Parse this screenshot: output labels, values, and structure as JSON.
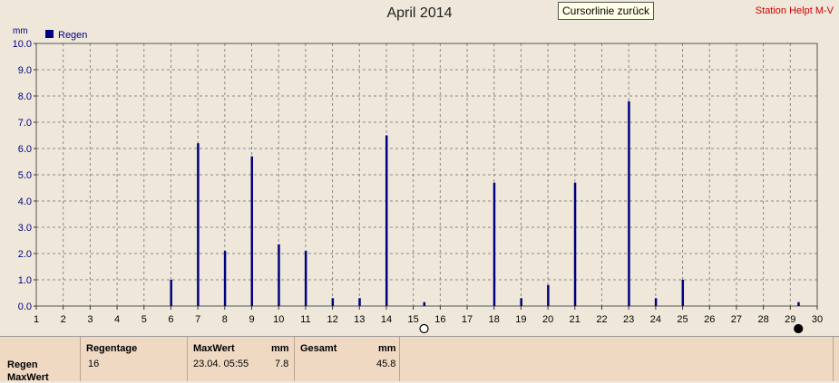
{
  "chart_data": {
    "type": "bar",
    "title": "April 2014",
    "ylabel": "mm",
    "ylim": [
      0,
      10
    ],
    "y_ticks": [
      "0.0",
      "1.0",
      "2.0",
      "3.0",
      "4.0",
      "5.0",
      "6.0",
      "7.0",
      "8.0",
      "9.0",
      "10.0"
    ],
    "xlim": [
      1,
      30
    ],
    "x_ticks": [
      "1",
      "2",
      "3",
      "4",
      "5",
      "6",
      "7",
      "8",
      "9",
      "10",
      "11",
      "12",
      "13",
      "14",
      "15",
      "16",
      "17",
      "18",
      "19",
      "20",
      "21",
      "22",
      "23",
      "24",
      "25",
      "26",
      "27",
      "28",
      "29",
      "30"
    ],
    "grid": true,
    "legend": "top-left",
    "series": [
      {
        "name": "Regen",
        "color": "#000080",
        "x": [
          6,
          7,
          8,
          9,
          10,
          11,
          12,
          13,
          14,
          15.4,
          18,
          19,
          20,
          21,
          23,
          24,
          25,
          29.3
        ],
        "values": [
          1.0,
          6.2,
          2.1,
          5.7,
          2.35,
          2.1,
          0.3,
          0.3,
          6.5,
          0.15,
          4.7,
          0.3,
          0.8,
          4.7,
          7.8,
          0.3,
          1.0,
          0.15
        ]
      }
    ],
    "cursor_markers": [
      {
        "x": 15.4,
        "style": "hollow"
      },
      {
        "x": 29.3,
        "style": "filled"
      }
    ]
  },
  "header": {
    "button_label": "Cursorlinie zurück",
    "station": "Station Helpt M-V"
  },
  "summary": {
    "row_labels": [
      "Regen",
      "MaxWert"
    ],
    "regentage_label": "Regentage",
    "regentage_value": "16",
    "maxwert_label": "MaxWert",
    "maxwert_unit": "mm",
    "maxwert_time": "23.04.  05:55",
    "maxwert_value": "7.8",
    "gesamt_label": "Gesamt",
    "gesamt_unit": "mm",
    "gesamt_value": "45.8"
  }
}
